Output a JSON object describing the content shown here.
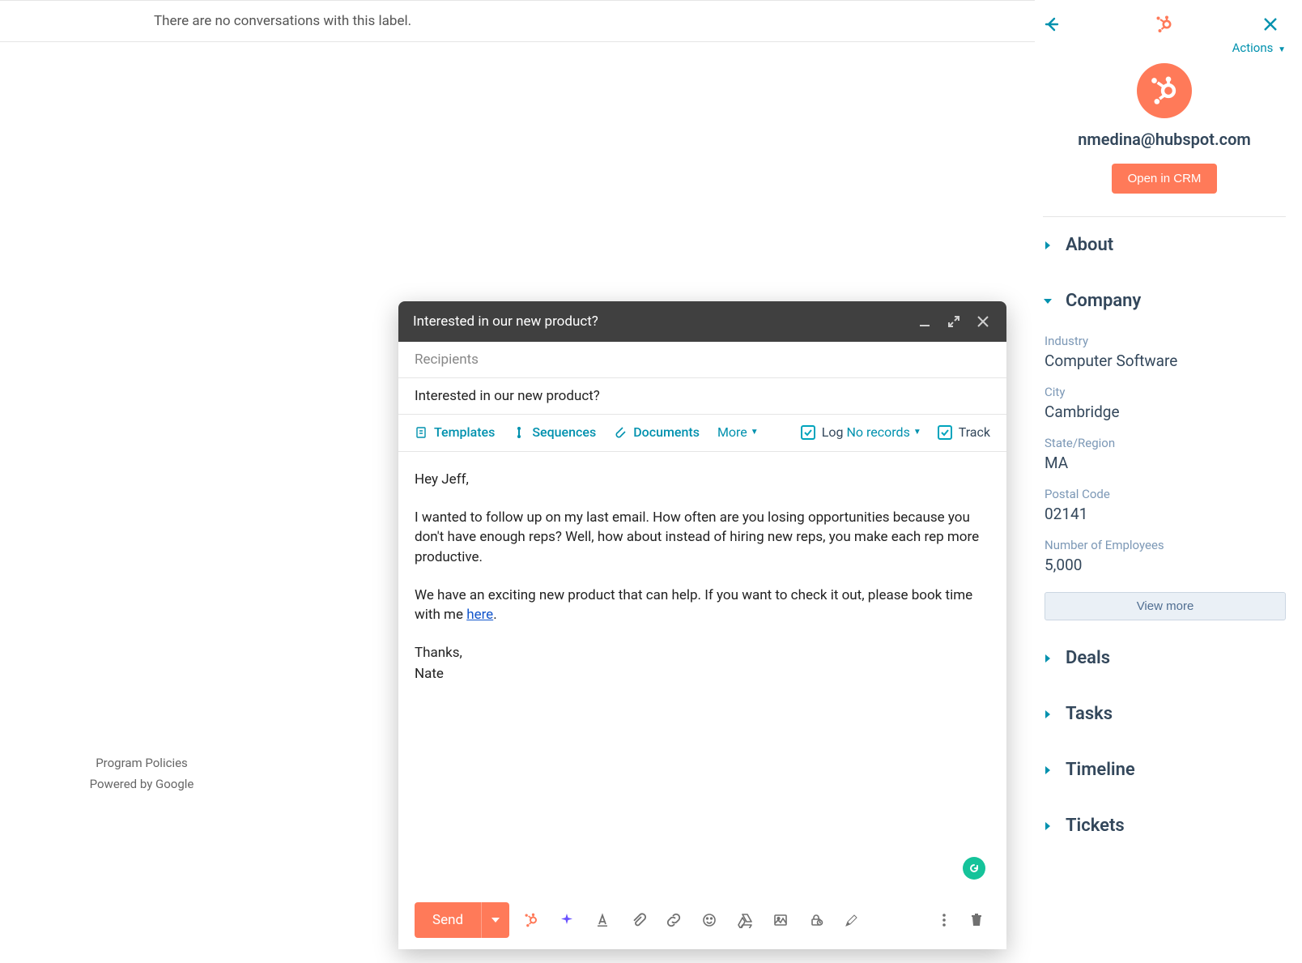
{
  "main": {
    "empty_message": "There are no conversations with this label.",
    "footer_line1": "Program Policies",
    "footer_line2": "Powered by Google"
  },
  "compose": {
    "title": "Interested in our new product?",
    "recipients_placeholder": "Recipients",
    "subject": "Interested in our new product?",
    "toolbar": {
      "templates": "Templates",
      "sequences": "Sequences",
      "documents": "Documents",
      "more": "More",
      "log": "Log",
      "no_records": "No records",
      "track": "Track"
    },
    "body": {
      "greeting": "Hey Jeff,",
      "p1": "I wanted to follow up on my last email. How often are you losing opportunities because you don't have enough reps? Well, how about instead of hiring new reps, you make each rep more productive.",
      "p2_a": "We have an exciting new product that can help. If you want to check it out, please book time with me ",
      "p2_link": "here",
      "p2_b": ".",
      "signoff1": "Thanks,",
      "signoff2": "Nate"
    },
    "send_label": "Send"
  },
  "side": {
    "actions_label": "Actions",
    "email": "nmedina@hubspot.com",
    "open_crm": "Open in CRM",
    "sections": {
      "about": "About",
      "company": "Company",
      "deals": "Deals",
      "tasks": "Tasks",
      "timeline": "Timeline",
      "tickets": "Tickets"
    },
    "company": {
      "industry_label": "Industry",
      "industry_value": "Computer Software",
      "city_label": "City",
      "city_value": "Cambridge",
      "state_label": "State/Region",
      "state_value": "MA",
      "postal_label": "Postal Code",
      "postal_value": "02141",
      "employees_label": "Number of Employees",
      "employees_value": "5,000",
      "view_more": "View more"
    }
  }
}
